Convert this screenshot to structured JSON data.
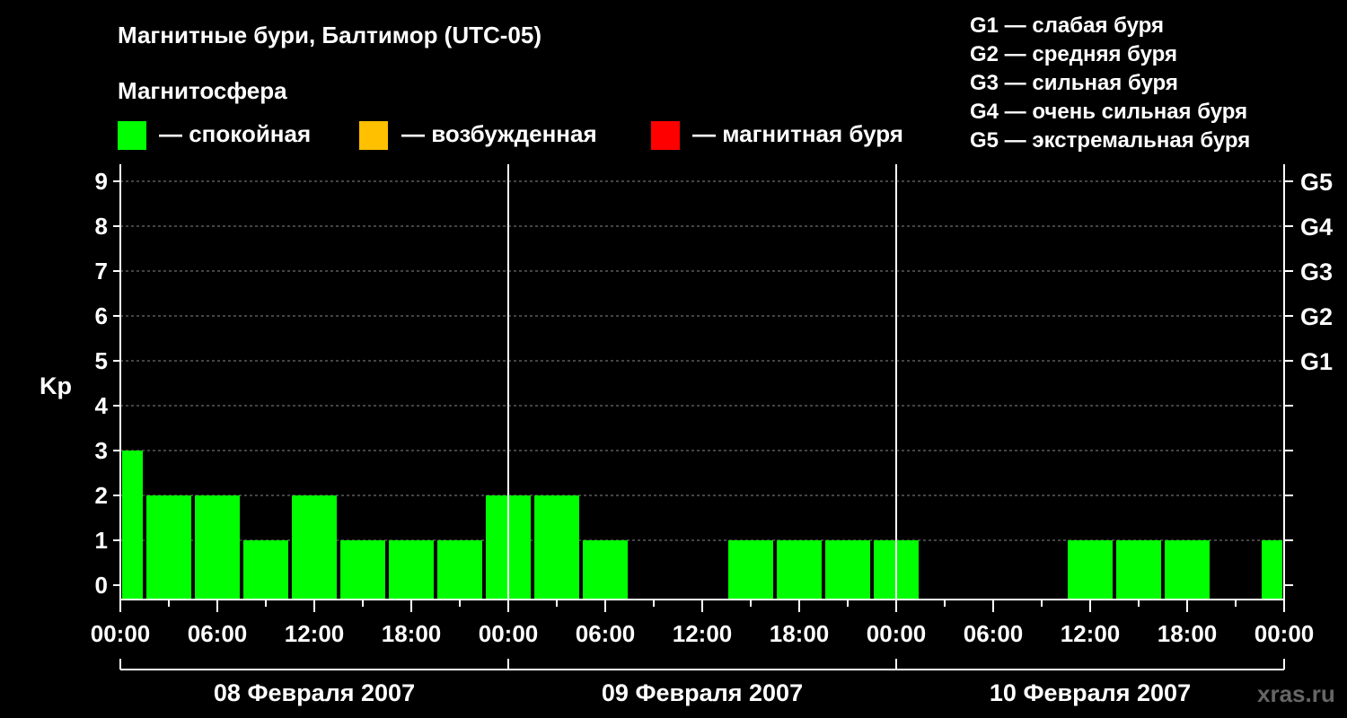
{
  "chart_data": {
    "type": "bar",
    "title": "Магнитные бури, Балтимор (UTC-05)",
    "legend": {
      "title": "Магнитосфера",
      "items": [
        {
          "label": "— спокойная",
          "color": "#00ff00"
        },
        {
          "label": "— возбужденная",
          "color": "#ffc000"
        },
        {
          "label": "— магнитная буря",
          "color": "#ff0000"
        }
      ]
    },
    "g_scale": [
      "G1 — слабая буря",
      "G2 — средняя буря",
      "G3 — сильная буря",
      "G4 — очень сильная буря",
      "G5 — экстремальная буря"
    ],
    "ylabel": "Kp",
    "ylim": [
      0,
      9
    ],
    "y_ticks": [
      "0",
      "1",
      "2",
      "3",
      "4",
      "5",
      "6",
      "7",
      "8",
      "9"
    ],
    "right_ticks": [
      {
        "value": 5,
        "label": "G1"
      },
      {
        "value": 6,
        "label": "G2"
      },
      {
        "value": 7,
        "label": "G3"
      },
      {
        "value": 8,
        "label": "G4"
      },
      {
        "value": 9,
        "label": "G5"
      }
    ],
    "x_tick_labels": [
      "00:00",
      "06:00",
      "12:00",
      "18:00",
      "00:00",
      "06:00",
      "12:00",
      "18:00",
      "00:00",
      "06:00",
      "12:00",
      "18:00",
      "00:00"
    ],
    "days": [
      "08 Февраля 2007",
      "09 Февраля 2007",
      "10 Февраля 2007"
    ],
    "interval_hours": 3,
    "values": [
      3,
      2,
      2,
      1,
      2,
      1,
      1,
      1,
      2,
      2,
      1,
      0,
      0,
      1,
      1,
      1,
      1,
      0,
      0,
      0,
      1,
      1,
      1,
      0,
      1
    ],
    "bar_color": "#00ff00",
    "grid": true
  },
  "watermark": "xras.ru"
}
